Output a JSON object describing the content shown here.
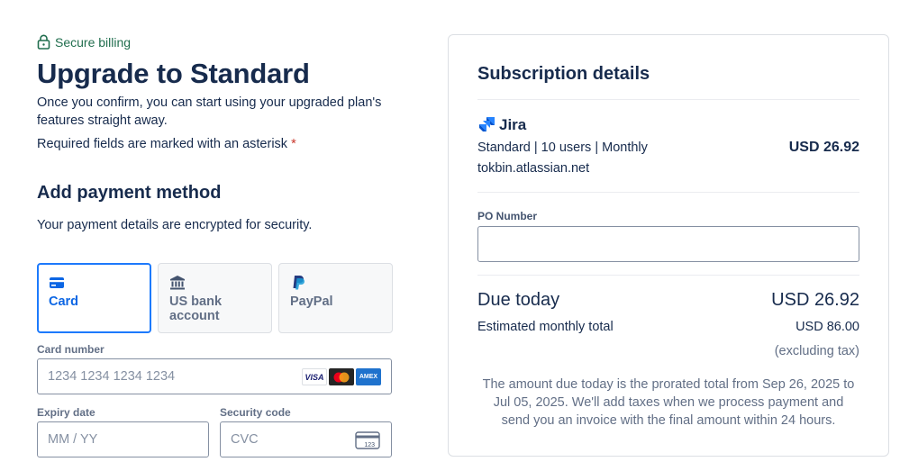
{
  "header": {
    "secure_label": "Secure billing",
    "title": "Upgrade to Standard",
    "intro": "Once you confirm, you can start using your upgraded plan's features straight away.",
    "required_note": "Required fields are marked with an asterisk",
    "asterisk": "*"
  },
  "payment": {
    "title": "Add payment method",
    "subtitle": "Your payment details are encrypted for security.",
    "tabs": [
      {
        "label": "Card",
        "icon": "credit-card-icon",
        "active": true
      },
      {
        "label": "US bank account",
        "icon": "bank-icon",
        "active": false
      },
      {
        "label": "PayPal",
        "icon": "paypal-icon",
        "active": false
      }
    ],
    "card_number": {
      "label": "Card number",
      "placeholder": "1234 1234 1234 1234",
      "brands": [
        "VISA",
        "Mastercard",
        "AMEX"
      ]
    },
    "expiry": {
      "label": "Expiry date",
      "placeholder": "MM / YY"
    },
    "security_code": {
      "label": "Security code",
      "placeholder": "CVC",
      "icon": "cvc-card-icon",
      "icon_text": "123"
    }
  },
  "subscription": {
    "title": "Subscription details",
    "product": "Jira",
    "plan": "Standard | 10 users | Monthly",
    "plan_price": "USD 26.92",
    "site": "tokbin.atlassian.net",
    "po_label": "PO Number",
    "po_value": "",
    "due_label": "Due today",
    "due_amount": "USD 26.92",
    "estimate_label": "Estimated monthly total",
    "estimate_amount": "USD 86.00",
    "tax_note": "(excluding tax)",
    "fine_print": "The amount due today is the prorated total from Sep 26, 2025 to Jul 05, 2025. We'll add taxes when we process payment and send you an invoice with the final amount within 24 hours."
  },
  "colors": {
    "accent": "#0c66e4",
    "secure_green": "#216e4e",
    "text": "#172b4d",
    "subtle_text": "#626f86",
    "required_red": "#c9372c"
  }
}
